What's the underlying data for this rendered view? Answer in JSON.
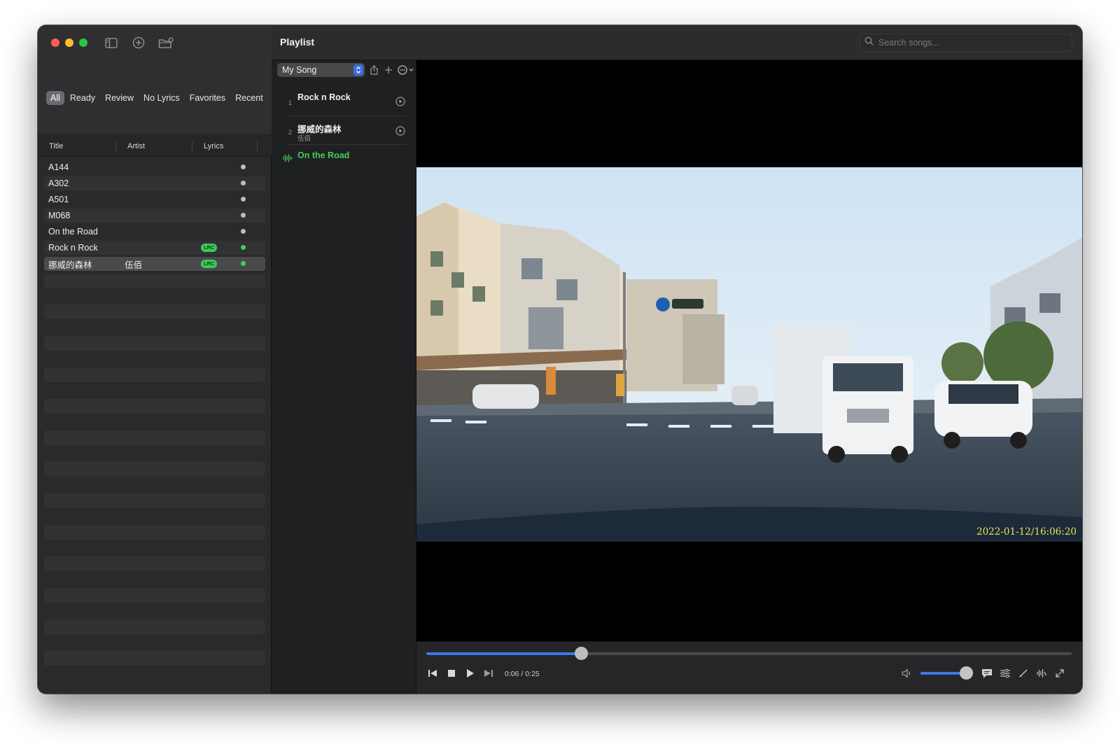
{
  "sidebar": {
    "filters": [
      {
        "label": "All",
        "active": true
      },
      {
        "label": "Ready",
        "active": false
      },
      {
        "label": "Review",
        "active": false
      },
      {
        "label": "No Lyrics",
        "active": false
      },
      {
        "label": "Favorites",
        "active": false
      },
      {
        "label": "Recent",
        "active": false
      }
    ],
    "columns": {
      "title": "Title",
      "artist": "Artist",
      "lyrics": "Lyrics"
    },
    "songs": [
      {
        "title": "A144",
        "artist": "",
        "lrc": false,
        "status": "grey"
      },
      {
        "title": "A302",
        "artist": "",
        "lrc": false,
        "status": "grey"
      },
      {
        "title": "A501",
        "artist": "",
        "lrc": false,
        "status": "grey"
      },
      {
        "title": "M068",
        "artist": "",
        "lrc": false,
        "status": "grey"
      },
      {
        "title": "On the Road",
        "artist": "",
        "lrc": false,
        "status": "grey"
      },
      {
        "title": "Rock n Rock",
        "artist": "",
        "lrc": true,
        "status": "green"
      },
      {
        "title": "挪威的森林",
        "artist": "伍佰",
        "lrc": true,
        "status": "green",
        "selected": true
      }
    ],
    "lrc_badge": "LRC"
  },
  "header": {
    "title": "Playlist",
    "search_placeholder": "Search songs..."
  },
  "playlist": {
    "selected": "My Song",
    "items": [
      {
        "number": "1",
        "name": "Rock n Rock",
        "subtitle": ""
      },
      {
        "number": "2",
        "name": "挪威的森林",
        "subtitle": "伍佰"
      }
    ],
    "now_playing": "On the Road"
  },
  "video": {
    "timestamp": "2022-01-12/16:06:20"
  },
  "player": {
    "time": "0:06 / 0:25",
    "progress": 0.24,
    "volume": 0.98
  },
  "colors": {
    "accent": "#3a79e8",
    "playing_green": "#3fcf5c",
    "lrc_badge": "#3cc95a"
  }
}
